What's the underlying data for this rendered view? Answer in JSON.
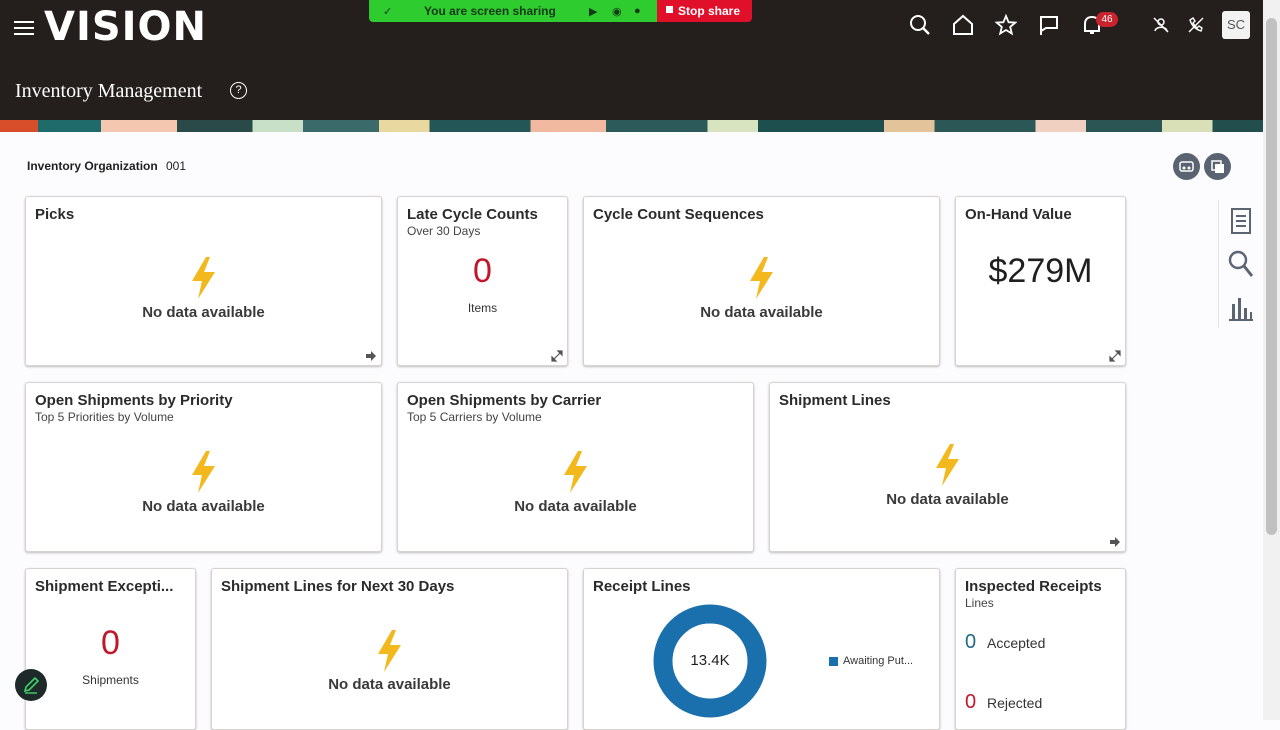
{
  "header": {
    "logo": "VISION",
    "page_title": "Inventory Management",
    "notification_count": "46",
    "avatar_initials": "SC"
  },
  "share_bar": {
    "message": "You are screen sharing",
    "stop_label": "Stop share",
    "bg_color": "#2ecc2e",
    "stop_color": "#e0102a"
  },
  "organization": {
    "label": "Inventory Organization",
    "value": "001"
  },
  "cards": {
    "picks": {
      "title": "Picks",
      "empty": "No data available"
    },
    "late_cycle": {
      "title": "Late Cycle Counts",
      "subtitle": "Over 30 Days",
      "value": "0",
      "caption": "Items"
    },
    "cycle_seq": {
      "title": "Cycle Count Sequences",
      "empty": "No data available"
    },
    "onhand": {
      "title": "On-Hand Value",
      "value": "$279M"
    },
    "ship_priority": {
      "title": "Open Shipments by Priority",
      "subtitle": "Top 5 Priorities by Volume",
      "empty": "No data available"
    },
    "ship_carrier": {
      "title": "Open Shipments by Carrier",
      "subtitle": "Top 5 Carriers by Volume",
      "empty": "No data available"
    },
    "ship_lines": {
      "title": "Shipment Lines",
      "empty": "No data available"
    },
    "ship_exceptions": {
      "title": "Shipment Excepti...",
      "value": "0",
      "caption": "Shipments"
    },
    "ship_next30": {
      "title": "Shipment Lines for Next 30 Days",
      "empty": "No data available"
    },
    "receipt_lines": {
      "title": "Receipt Lines",
      "donut_label": "13.4K",
      "legend": "Awaiting Put...",
      "color": "#1a6fad"
    },
    "inspected": {
      "title": "Inspected Receipts",
      "subtitle": "Lines",
      "accepted_value": "0",
      "accepted_label": "Accepted",
      "rejected_value": "0",
      "rejected_label": "Rejected"
    }
  },
  "colors": {
    "header_bg": "#241f1c",
    "alert_red": "#c2162a",
    "teal_value": "#1f6b8a",
    "bolt_yellow": "#f2b81c"
  },
  "icons": [
    "menu-icon",
    "search-icon",
    "home-icon",
    "star-icon",
    "flag-icon",
    "bell-icon",
    "mic-off-icon",
    "phone-off-icon",
    "refresh-icon",
    "copy-icon",
    "report-icon",
    "search-panel-icon",
    "chart-icon",
    "edit-icon"
  ]
}
